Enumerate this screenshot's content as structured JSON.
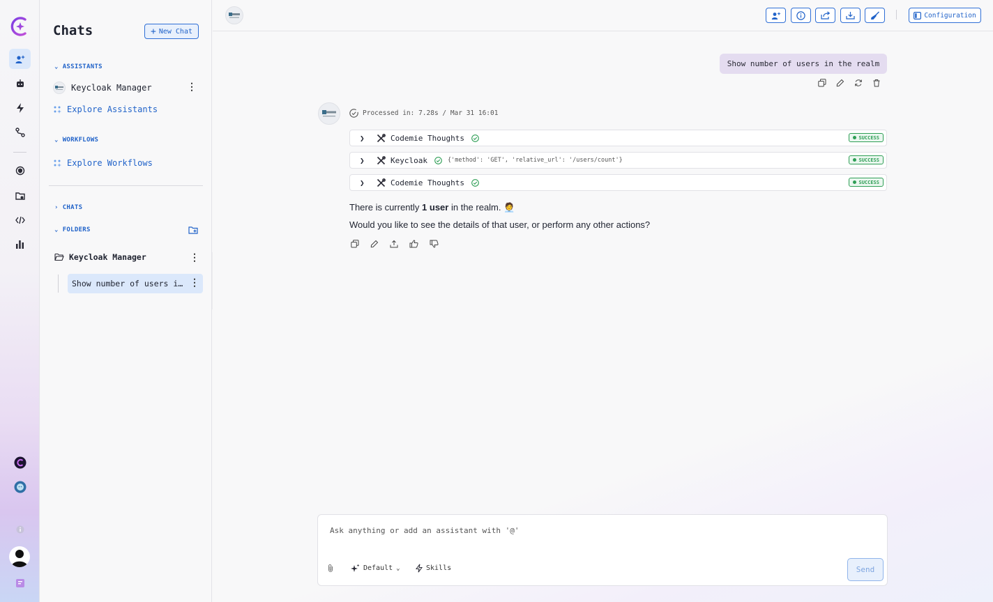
{
  "colors": {
    "accent": "#2163c9",
    "success": "#2e9e55",
    "selected": "#dbe8fb",
    "user_bubble": "#e4dcf0"
  },
  "rail": {
    "items": [
      "assistants-icon",
      "robot-icon",
      "lightning-icon",
      "workflow-icon",
      "shield-icon",
      "folder-icon",
      "code-icon",
      "chart-icon"
    ],
    "footer": [
      "codemie-icon",
      "lion-icon",
      "info-icon",
      "avatar",
      "docs-icon"
    ]
  },
  "sidebar": {
    "title": "Chats",
    "new_chat": "New Chat",
    "assistants": {
      "heading": "ASSISTANTS",
      "item": "Keycloak Manager",
      "explore": "Explore Assistants"
    },
    "workflows": {
      "heading": "WORKFLOWS",
      "explore": "Explore Workflows"
    },
    "chats_heading": "CHATS",
    "folders_heading": "FOLDERS",
    "folder": "Keycloak Manager",
    "chat_item": "Show number of users i…"
  },
  "topbar": {
    "configuration": "Configuration",
    "icons": [
      "add-assistant-icon",
      "info-icon",
      "share-icon",
      "download-icon",
      "clear-icon"
    ]
  },
  "conversation": {
    "user_message": "Show number of users in the realm",
    "processed": "Processed in: 7.28s / Mar 31 16:01",
    "tools": [
      {
        "name": "Codemie Thoughts",
        "args": "",
        "status": "SUCCESS"
      },
      {
        "name": "Keycloak",
        "args": "{'method': 'GET', 'relative_url': '/users/count'}",
        "status": "SUCCESS"
      },
      {
        "name": "Codemie Thoughts",
        "args": "",
        "status": "SUCCESS"
      }
    ],
    "answer_prefix": "There is currently ",
    "answer_bold": "1 user",
    "answer_suffix": " in the realm. 🧑‍💼",
    "answer_line2": "Would you like to see the details of that user, or perform any other actions?"
  },
  "composer": {
    "placeholder": "Ask anything or add an assistant with '@'",
    "model": "Default",
    "skills": "Skills",
    "send": "Send"
  }
}
